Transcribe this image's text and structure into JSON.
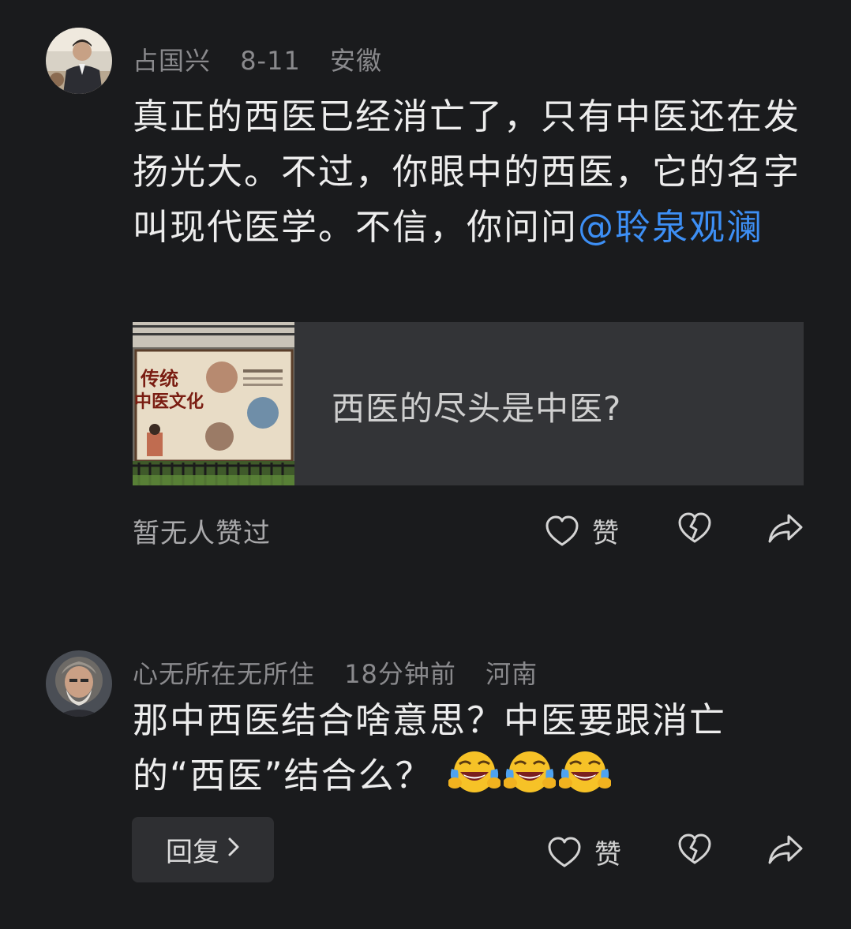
{
  "comments": [
    {
      "author": "占国兴",
      "date": "8-11",
      "location": "安徽",
      "text_plain": "真正的西医已经消亡了，只有中医还在发扬光大。不过，你眼中的西医，它的名字叫现代医学。不信，你问问",
      "mention": "@聆泉观澜",
      "link_card": {
        "title": "西医的尽头是中医?",
        "thumbnail_text": "传统中医文化"
      },
      "likes_status": "暂无人赞过",
      "like_label": "赞"
    },
    {
      "author": "心无所在无所住",
      "date": "18分钟前",
      "location": "河南",
      "text_plain": "那中西医结合啥意思？中医要跟消亡的“西医”结合么？",
      "emoji": "laugh-cry",
      "emoji_count": 3,
      "reply_label": "回复",
      "like_label": "赞"
    }
  ],
  "icons": {
    "like": "heart-icon",
    "dislike": "broken-heart-icon",
    "share": "share-arrow-icon",
    "chevron": "chevron-right-icon"
  },
  "colors": {
    "background": "#1a1b1d",
    "mention": "#3d8ff5",
    "meta": "#8a8a8d"
  }
}
